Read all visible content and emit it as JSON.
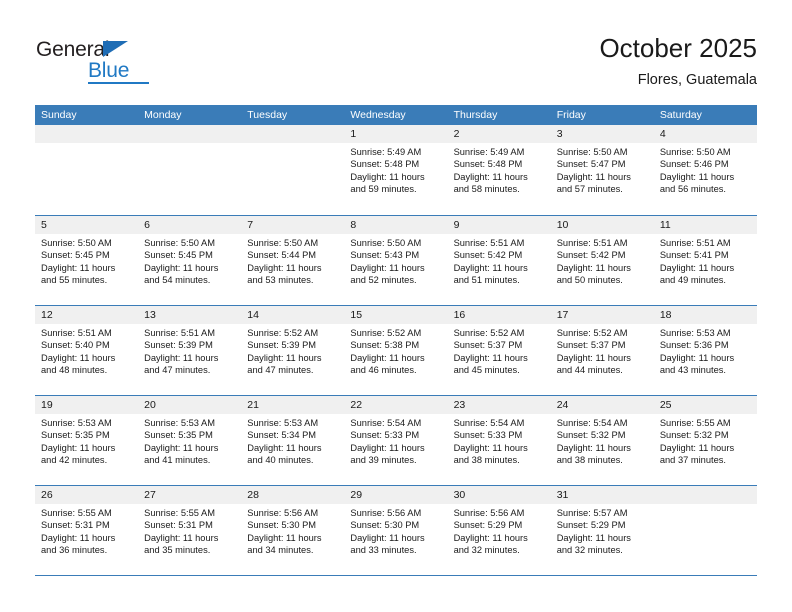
{
  "branding": {
    "logo_text_primary": "General",
    "logo_text_secondary": "Blue",
    "logo_accent_color": "#2079c4"
  },
  "header": {
    "month_title": "October 2025",
    "location": "Flores, Guatemala"
  },
  "theme": {
    "header_bar_color": "#3a7cb8",
    "daynum_strip_color": "#f0f0f0",
    "text_color": "#1a1a1a",
    "page_background": "#ffffff"
  },
  "calendar": {
    "day_headers": [
      "Sunday",
      "Monday",
      "Tuesday",
      "Wednesday",
      "Thursday",
      "Friday",
      "Saturday"
    ],
    "labels": {
      "sunrise": "Sunrise:",
      "sunset": "Sunset:",
      "daylight": "Daylight:"
    },
    "weeks": [
      [
        {
          "day": "",
          "empty": true
        },
        {
          "day": "",
          "empty": true
        },
        {
          "day": "",
          "empty": true
        },
        {
          "day": "1",
          "sunrise": "Sunrise: 5:49 AM",
          "sunset": "Sunset: 5:48 PM",
          "daylight": "Daylight: 11 hours and 59 minutes."
        },
        {
          "day": "2",
          "sunrise": "Sunrise: 5:49 AM",
          "sunset": "Sunset: 5:48 PM",
          "daylight": "Daylight: 11 hours and 58 minutes."
        },
        {
          "day": "3",
          "sunrise": "Sunrise: 5:50 AM",
          "sunset": "Sunset: 5:47 PM",
          "daylight": "Daylight: 11 hours and 57 minutes."
        },
        {
          "day": "4",
          "sunrise": "Sunrise: 5:50 AM",
          "sunset": "Sunset: 5:46 PM",
          "daylight": "Daylight: 11 hours and 56 minutes."
        }
      ],
      [
        {
          "day": "5",
          "sunrise": "Sunrise: 5:50 AM",
          "sunset": "Sunset: 5:45 PM",
          "daylight": "Daylight: 11 hours and 55 minutes."
        },
        {
          "day": "6",
          "sunrise": "Sunrise: 5:50 AM",
          "sunset": "Sunset: 5:45 PM",
          "daylight": "Daylight: 11 hours and 54 minutes."
        },
        {
          "day": "7",
          "sunrise": "Sunrise: 5:50 AM",
          "sunset": "Sunset: 5:44 PM",
          "daylight": "Daylight: 11 hours and 53 minutes."
        },
        {
          "day": "8",
          "sunrise": "Sunrise: 5:50 AM",
          "sunset": "Sunset: 5:43 PM",
          "daylight": "Daylight: 11 hours and 52 minutes."
        },
        {
          "day": "9",
          "sunrise": "Sunrise: 5:51 AM",
          "sunset": "Sunset: 5:42 PM",
          "daylight": "Daylight: 11 hours and 51 minutes."
        },
        {
          "day": "10",
          "sunrise": "Sunrise: 5:51 AM",
          "sunset": "Sunset: 5:42 PM",
          "daylight": "Daylight: 11 hours and 50 minutes."
        },
        {
          "day": "11",
          "sunrise": "Sunrise: 5:51 AM",
          "sunset": "Sunset: 5:41 PM",
          "daylight": "Daylight: 11 hours and 49 minutes."
        }
      ],
      [
        {
          "day": "12",
          "sunrise": "Sunrise: 5:51 AM",
          "sunset": "Sunset: 5:40 PM",
          "daylight": "Daylight: 11 hours and 48 minutes."
        },
        {
          "day": "13",
          "sunrise": "Sunrise: 5:51 AM",
          "sunset": "Sunset: 5:39 PM",
          "daylight": "Daylight: 11 hours and 47 minutes."
        },
        {
          "day": "14",
          "sunrise": "Sunrise: 5:52 AM",
          "sunset": "Sunset: 5:39 PM",
          "daylight": "Daylight: 11 hours and 47 minutes."
        },
        {
          "day": "15",
          "sunrise": "Sunrise: 5:52 AM",
          "sunset": "Sunset: 5:38 PM",
          "daylight": "Daylight: 11 hours and 46 minutes."
        },
        {
          "day": "16",
          "sunrise": "Sunrise: 5:52 AM",
          "sunset": "Sunset: 5:37 PM",
          "daylight": "Daylight: 11 hours and 45 minutes."
        },
        {
          "day": "17",
          "sunrise": "Sunrise: 5:52 AM",
          "sunset": "Sunset: 5:37 PM",
          "daylight": "Daylight: 11 hours and 44 minutes."
        },
        {
          "day": "18",
          "sunrise": "Sunrise: 5:53 AM",
          "sunset": "Sunset: 5:36 PM",
          "daylight": "Daylight: 11 hours and 43 minutes."
        }
      ],
      [
        {
          "day": "19",
          "sunrise": "Sunrise: 5:53 AM",
          "sunset": "Sunset: 5:35 PM",
          "daylight": "Daylight: 11 hours and 42 minutes."
        },
        {
          "day": "20",
          "sunrise": "Sunrise: 5:53 AM",
          "sunset": "Sunset: 5:35 PM",
          "daylight": "Daylight: 11 hours and 41 minutes."
        },
        {
          "day": "21",
          "sunrise": "Sunrise: 5:53 AM",
          "sunset": "Sunset: 5:34 PM",
          "daylight": "Daylight: 11 hours and 40 minutes."
        },
        {
          "day": "22",
          "sunrise": "Sunrise: 5:54 AM",
          "sunset": "Sunset: 5:33 PM",
          "daylight": "Daylight: 11 hours and 39 minutes."
        },
        {
          "day": "23",
          "sunrise": "Sunrise: 5:54 AM",
          "sunset": "Sunset: 5:33 PM",
          "daylight": "Daylight: 11 hours and 38 minutes."
        },
        {
          "day": "24",
          "sunrise": "Sunrise: 5:54 AM",
          "sunset": "Sunset: 5:32 PM",
          "daylight": "Daylight: 11 hours and 38 minutes."
        },
        {
          "day": "25",
          "sunrise": "Sunrise: 5:55 AM",
          "sunset": "Sunset: 5:32 PM",
          "daylight": "Daylight: 11 hours and 37 minutes."
        }
      ],
      [
        {
          "day": "26",
          "sunrise": "Sunrise: 5:55 AM",
          "sunset": "Sunset: 5:31 PM",
          "daylight": "Daylight: 11 hours and 36 minutes."
        },
        {
          "day": "27",
          "sunrise": "Sunrise: 5:55 AM",
          "sunset": "Sunset: 5:31 PM",
          "daylight": "Daylight: 11 hours and 35 minutes."
        },
        {
          "day": "28",
          "sunrise": "Sunrise: 5:56 AM",
          "sunset": "Sunset: 5:30 PM",
          "daylight": "Daylight: 11 hours and 34 minutes."
        },
        {
          "day": "29",
          "sunrise": "Sunrise: 5:56 AM",
          "sunset": "Sunset: 5:30 PM",
          "daylight": "Daylight: 11 hours and 33 minutes."
        },
        {
          "day": "30",
          "sunrise": "Sunrise: 5:56 AM",
          "sunset": "Sunset: 5:29 PM",
          "daylight": "Daylight: 11 hours and 32 minutes."
        },
        {
          "day": "31",
          "sunrise": "Sunrise: 5:57 AM",
          "sunset": "Sunset: 5:29 PM",
          "daylight": "Daylight: 11 hours and 32 minutes."
        },
        {
          "day": "",
          "empty": true
        }
      ]
    ]
  }
}
